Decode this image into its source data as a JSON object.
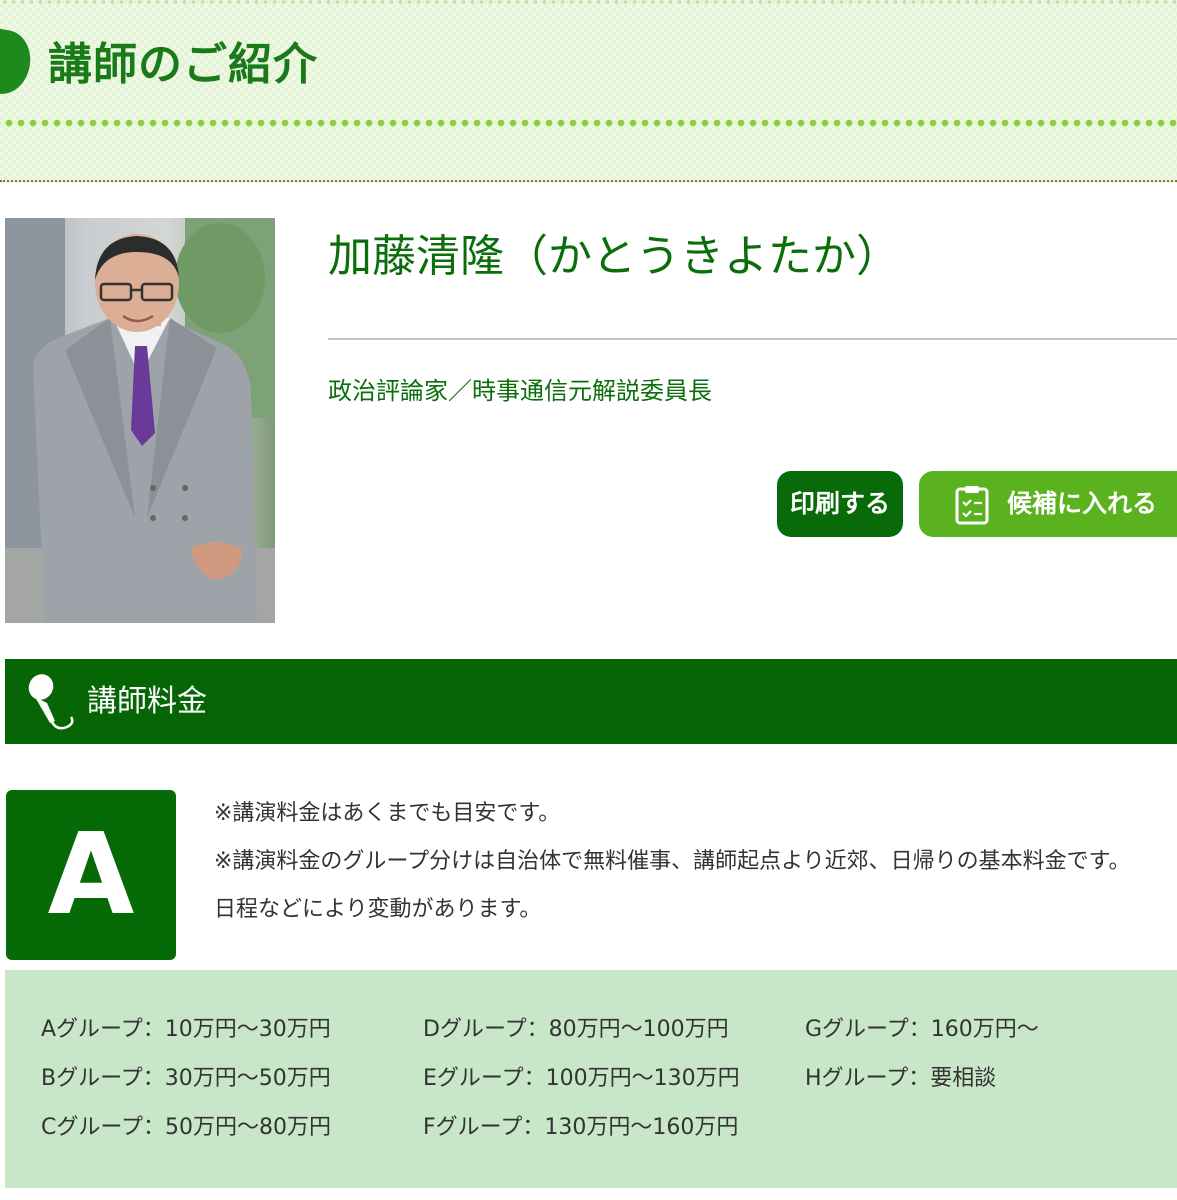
{
  "header": {
    "title": "講師のご紹介"
  },
  "speaker": {
    "name": "加藤清隆（かとうきよたか）",
    "title": "政治評論家／時事通信元解説委員長"
  },
  "actions": {
    "print_label": "印刷する",
    "candidate_label": "候補に入れる"
  },
  "fee_section": {
    "title": "講師料金",
    "grade": "A",
    "notes": [
      "※講演料金はあくまでも目安です。",
      "※講演料金のグループ分けは自治体で無料催事、講師起点より近郊、日帰りの基本料金です。",
      "日程などにより変動があります。"
    ],
    "groups": [
      [
        "Aグループ：10万円〜30万円",
        "Bグループ：30万円〜50万円",
        "Cグループ：50万円〜80万円"
      ],
      [
        "Dグループ：80万円〜100万円",
        "Eグループ：100万円〜130万円",
        "Fグループ：130万円〜160万円"
      ],
      [
        "Gグループ：160万円〜",
        "Hグループ：要相談"
      ]
    ]
  },
  "colors": {
    "brand_dark": "#066606",
    "brand_light": "#5ab21f",
    "title_green": "#1a7a1a",
    "table_bg": "#c8e6c8"
  },
  "icons": {
    "header": "leaf-icon",
    "fee": "microphone-icon",
    "candidate": "clipboard-icon"
  }
}
